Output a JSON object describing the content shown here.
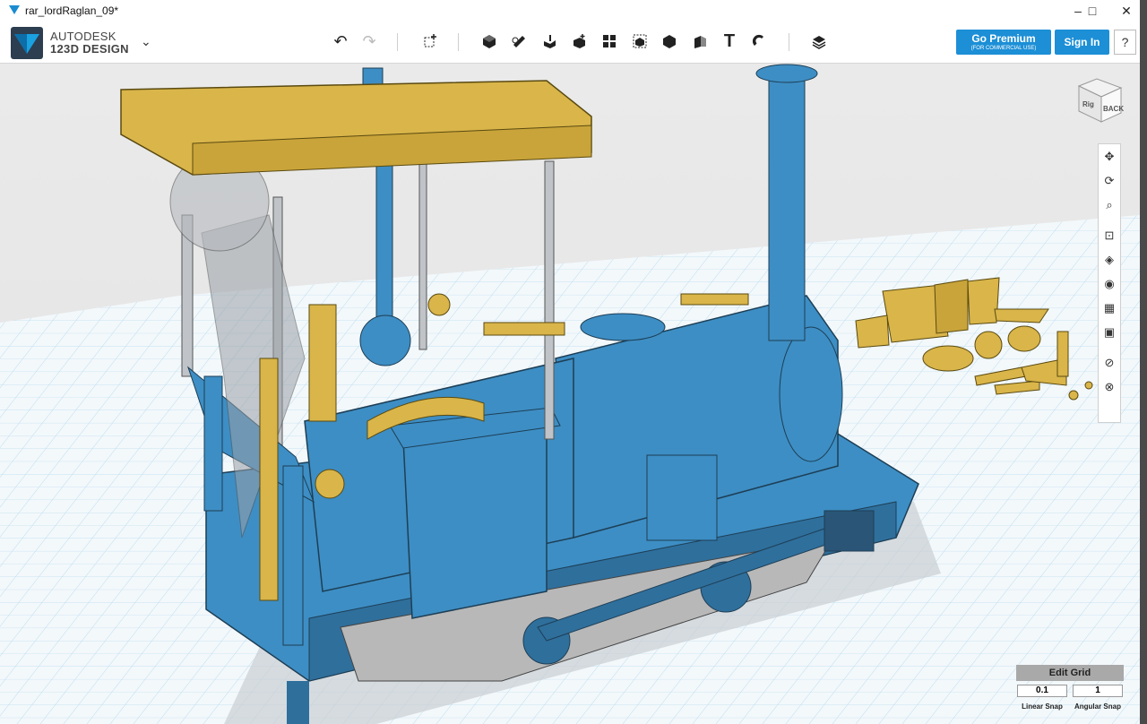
{
  "window": {
    "title": "rar_lordRaglan_09*"
  },
  "window_controls": {
    "minimize": "–",
    "maximize": "□",
    "close": "✕"
  },
  "brand": {
    "line1": "AUTODESK",
    "line2": "123D",
    "line2b": " DESIGN"
  },
  "toolbar": {
    "undo_icon": "↶",
    "redo_icon": "↷",
    "text_tool": "T"
  },
  "account": {
    "premium": "Go Premium",
    "premium_sub": "(FOR COMMERCIAL USE)",
    "sign_in": "Sign In",
    "help": "?"
  },
  "viewcube": {
    "face1": "BACK",
    "face2": "Rig"
  },
  "grid": {
    "title": "Edit Grid",
    "linear_snap_value": "0.1",
    "angular_snap_value": "1",
    "linear_snap_label": "Linear Snap",
    "angular_snap_label": "Angular Snap"
  },
  "colors": {
    "accent": "#1c8fd6",
    "model_blue": "#3d8ec4",
    "brass": "#d9b54a",
    "grid": "#a9d4ec"
  }
}
